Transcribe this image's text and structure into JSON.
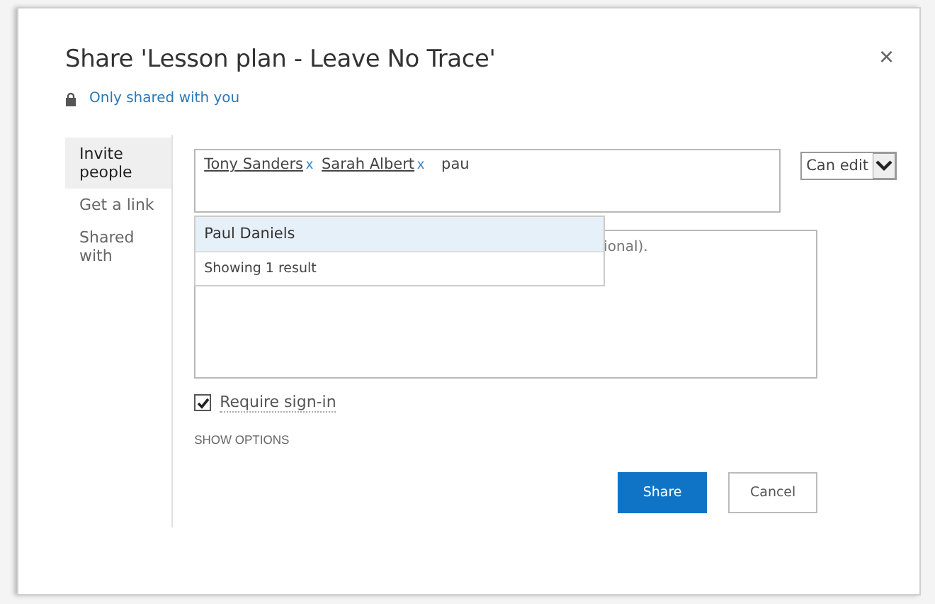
{
  "dialog": {
    "title": "Share 'Lesson plan - Leave No Trace'",
    "close": "×",
    "sharing_status": "Only shared with you"
  },
  "sidebar": {
    "items": [
      {
        "label": "Invite people",
        "selected": true
      },
      {
        "label": "Get a link",
        "selected": false
      },
      {
        "label": "Shared with",
        "selected": false
      }
    ]
  },
  "invite": {
    "people": [
      {
        "name": "Tony Sanders",
        "remove": "x"
      },
      {
        "name": "Sarah Albert",
        "remove": "x"
      }
    ],
    "typed": "pau",
    "permission": "Can edit",
    "suggestions": [
      {
        "name": "Paul Daniels",
        "selected": true
      }
    ],
    "result_count": "Showing 1 result",
    "message_visible": "ional).",
    "require_sign_in": {
      "label": "Require sign-in",
      "checked": true
    },
    "show_options": "SHOW OPTIONS"
  },
  "buttons": [
    {
      "label": "Share",
      "kind": "primary"
    },
    {
      "label": "Cancel",
      "kind": "secondary"
    }
  ]
}
